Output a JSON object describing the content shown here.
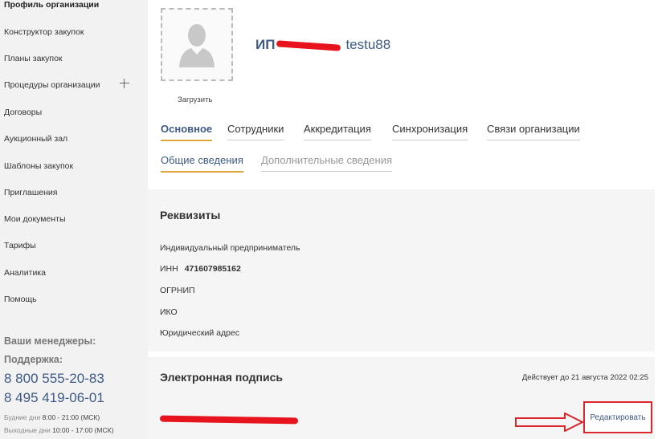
{
  "sidebar": {
    "items": [
      {
        "label": "Профиль организации",
        "active": true
      },
      {
        "label": "Конструктор закупок"
      },
      {
        "label": "Планы закупок"
      },
      {
        "label": "Процедуры организации"
      },
      {
        "label": "Договоры"
      },
      {
        "label": "Аукционный зал"
      },
      {
        "label": "Шаблоны закупок"
      },
      {
        "label": "Приглашения"
      },
      {
        "label": "Мои документы"
      },
      {
        "label": "Тарифы"
      },
      {
        "label": "Аналитика"
      },
      {
        "label": "Помощь"
      }
    ],
    "managers_title": "Ваши менеджеры:",
    "support_title": "Поддержка:",
    "phones": [
      "8 800 555-20-83",
      "8 495 419-06-01"
    ],
    "weekdays_label": "Будние дни",
    "weekdays_hours": "8:00 - 21:00 (МСК)",
    "weekend_label": "Выходные дни",
    "weekend_hours": "10:00 - 17:00 (МСК)"
  },
  "profile": {
    "upload_label": "Загрузить",
    "title_prefix": "ИП",
    "title_suffix": "testu88"
  },
  "tabs": [
    "Основное",
    "Сотрудники",
    "Аккредитация",
    "Синхронизация",
    "Связи организации"
  ],
  "subtabs": [
    "Общие сведения",
    "Дополнительные сведения"
  ],
  "requisites": {
    "title": "Реквизиты",
    "entity_type": "Индивидуальный предприниматель",
    "inn_label": "ИНН",
    "inn_value": "471607985162",
    "ogrnip_label": "ОГРНИП",
    "iko_label": "ИКО",
    "address_label": "Юридический адрес"
  },
  "signature": {
    "title": "Электронная подпись",
    "valid_until": "Действует до 21 августа 2022 02:25",
    "edit_label": "Редактировать"
  },
  "colors": {
    "accent": "#3e5a85",
    "tab_underline": "#e0a43a",
    "highlight": "#d9272e"
  }
}
